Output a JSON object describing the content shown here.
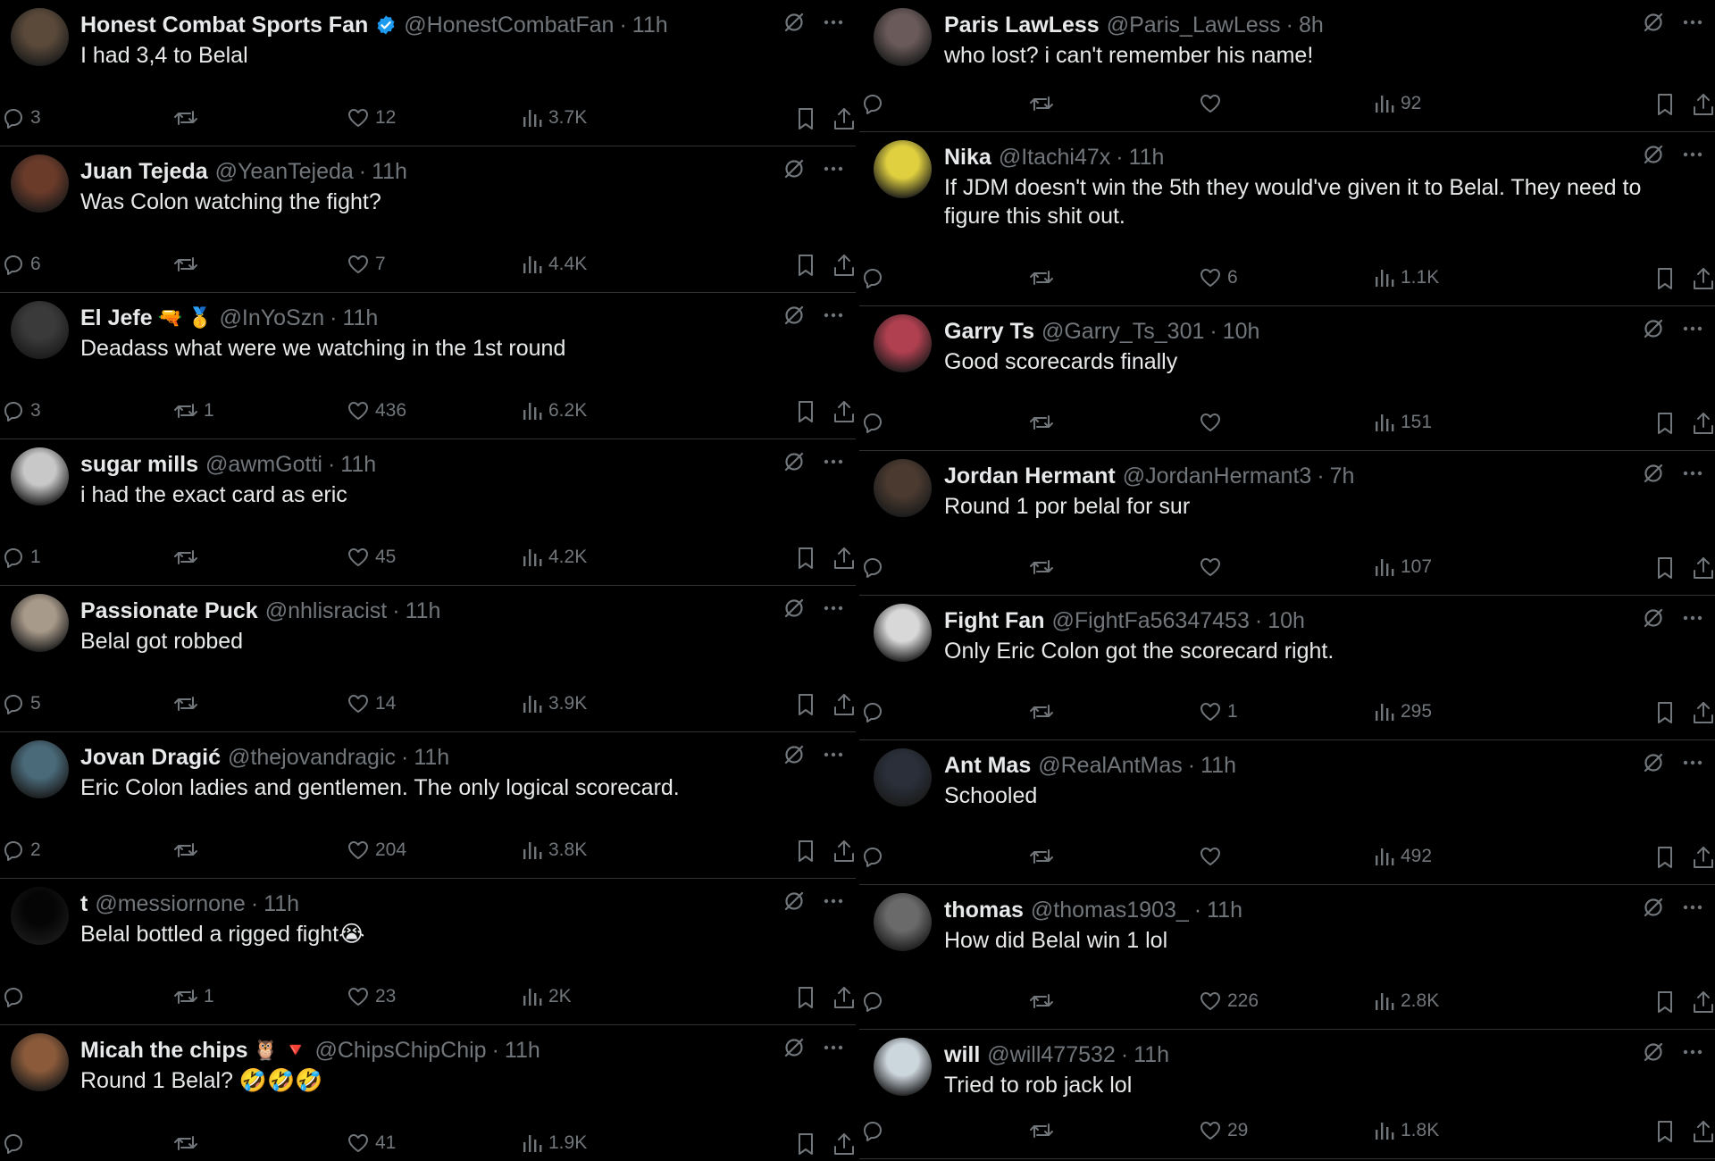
{
  "left_column": [
    {
      "name": "Honest Combat Sports Fan",
      "verified": true,
      "badges": "",
      "handle": "@HonestCombatFan",
      "time": "11h",
      "text": "I had 3,4 to Belal",
      "replies": "3",
      "retweets": "",
      "likes": "12",
      "views": "3.7K",
      "avatar_color": "#5b4a3a"
    },
    {
      "name": "Juan Tejeda",
      "verified": false,
      "badges": "",
      "handle": "@YeanTejeda",
      "time": "11h",
      "text": "Was Colon watching the fight?",
      "replies": "6",
      "retweets": "",
      "likes": "7",
      "views": "4.4K",
      "avatar_color": "#6b3b2a"
    },
    {
      "name": "El Jefe",
      "verified": false,
      "badges": "🔫 🥇",
      "handle": "@InYoSzn",
      "time": "11h",
      "text": "Deadass what were we watching in the 1st round",
      "replies": "3",
      "retweets": "1",
      "likes": "436",
      "views": "6.2K",
      "avatar_color": "#3a3a3a"
    },
    {
      "name": "sugar mills",
      "verified": false,
      "badges": "",
      "handle": "@awmGotti",
      "time": "11h",
      "text": "i had the exact card as eric",
      "replies": "1",
      "retweets": "",
      "likes": "45",
      "views": "4.2K",
      "avatar_color": "#c8c8c8"
    },
    {
      "name": "Passionate Puck",
      "verified": false,
      "badges": "",
      "handle": "@nhlisracist",
      "time": "11h",
      "text": "Belal got robbed",
      "replies": "5",
      "retweets": "",
      "likes": "14",
      "views": "3.9K",
      "avatar_color": "#a89a8a"
    },
    {
      "name": "Jovan Dragić",
      "verified": false,
      "badges": "",
      "handle": "@thejovandragic",
      "time": "11h",
      "text": "Eric Colon ladies and gentlemen. The only logical scorecard.",
      "replies": "2",
      "retweets": "",
      "likes": "204",
      "views": "3.8K",
      "avatar_color": "#4a6a7a"
    },
    {
      "name": "t",
      "verified": false,
      "badges": "",
      "handle": "@messiornone",
      "time": "11h",
      "text": "Belal bottled a rigged fight😭",
      "replies": "",
      "retweets": "1",
      "likes": "23",
      "views": "2K",
      "avatar_color": "#050505"
    },
    {
      "name": "Micah the chips",
      "verified": false,
      "badges": "🦉 🔻",
      "handle": "@ChipsChipChip",
      "time": "11h",
      "text": "Round 1 Belal? 🤣🤣🤣",
      "replies": "",
      "retweets": "",
      "likes": "41",
      "views": "1.9K",
      "avatar_color": "#8a5a3a"
    }
  ],
  "right_column": [
    {
      "name": "Paris LawLess",
      "verified": false,
      "badges": "",
      "handle": "@Paris_LawLess",
      "time": "8h",
      "text": "who lost? i can't remember his name!",
      "replies": "",
      "retweets": "",
      "likes": "",
      "views": "92",
      "avatar_color": "#6a5a5a"
    },
    {
      "name": "Nika",
      "verified": false,
      "badges": "",
      "handle": "@Itachi47x",
      "time": "11h",
      "text": "If JDM doesn't win the 5th they would've given it to Belal. They need to figure this shit out.",
      "replies": "",
      "retweets": "",
      "likes": "6",
      "views": "1.1K",
      "avatar_color": "#e0d040"
    },
    {
      "name": "Garry Ts",
      "verified": false,
      "badges": "",
      "handle": "@Garry_Ts_301",
      "time": "10h",
      "text": "Good scorecards finally",
      "replies": "",
      "retweets": "",
      "likes": "",
      "views": "151",
      "avatar_color": "#b04050"
    },
    {
      "name": "Jordan Hermant",
      "verified": false,
      "badges": "",
      "handle": "@JordanHermant3",
      "time": "7h",
      "text": "Round 1 por belal for sur",
      "replies": "",
      "retweets": "",
      "likes": "",
      "views": "107",
      "avatar_color": "#4a3a30"
    },
    {
      "name": "Fight Fan",
      "verified": false,
      "badges": "",
      "handle": "@FightFa56347453",
      "time": "10h",
      "text": "Only Eric Colon got the scorecard right.",
      "replies": "",
      "retweets": "",
      "likes": "1",
      "views": "295",
      "avatar_color": "#d8d8d8"
    },
    {
      "name": "Ant Mas",
      "verified": false,
      "badges": "",
      "handle": "@RealAntMas",
      "time": "11h",
      "text": "Schooled",
      "replies": "",
      "retweets": "",
      "likes": "",
      "views": "492",
      "avatar_color": "#2a2f3a"
    },
    {
      "name": "thomas",
      "verified": false,
      "badges": "",
      "handle": "@thomas1903_",
      "time": "11h",
      "text": "How did Belal win 1 lol",
      "replies": "",
      "retweets": "",
      "likes": "226",
      "views": "2.8K",
      "avatar_color": "#6a6a6a"
    },
    {
      "name": "will",
      "verified": false,
      "badges": "",
      "handle": "@will477532",
      "time": "11h",
      "text": "Tried to rob jack lol",
      "replies": "",
      "retweets": "",
      "likes": "29",
      "views": "1.8K",
      "avatar_color": "#ccd6dd"
    }
  ]
}
